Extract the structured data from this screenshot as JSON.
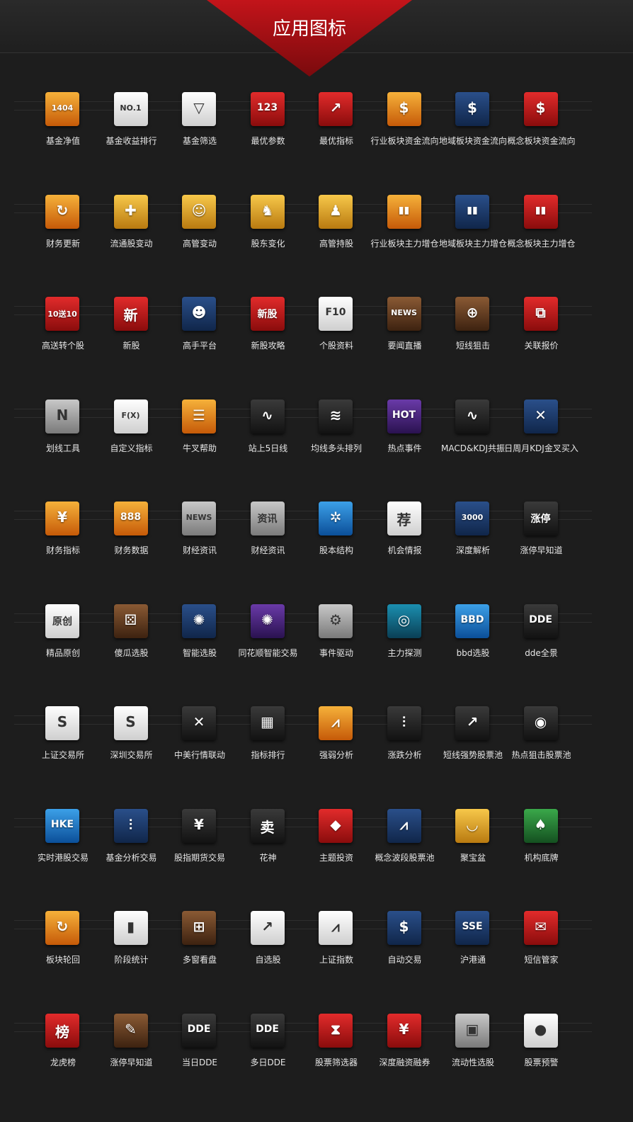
{
  "header": {
    "title": "应用图标"
  },
  "rows": [
    [
      {
        "label": "基金净值",
        "icon": "magnifier-numbers-icon",
        "glyph": "1404",
        "color": "orange"
      },
      {
        "label": "基金收益排行",
        "icon": "no1-coin-icon",
        "glyph": "NO.1",
        "color": "white"
      },
      {
        "label": "基金筛选",
        "icon": "funnel-icon",
        "glyph": "▽",
        "color": "white"
      },
      {
        "label": "最优参数",
        "icon": "number-grid-icon",
        "glyph": "123",
        "color": "red"
      },
      {
        "label": "最优指标",
        "icon": "arrow-up-chart-icon",
        "glyph": "↗",
        "color": "red"
      },
      {
        "label": "行业板块资金流向",
        "icon": "coins-arrow-icon",
        "glyph": "$",
        "color": "orange"
      },
      {
        "label": "地域板块资金流向",
        "icon": "coins-arrow-icon",
        "glyph": "$",
        "color": "navy"
      },
      {
        "label": "概念板块资金流向",
        "icon": "coins-arrow-icon",
        "glyph": "$",
        "color": "red"
      }
    ],
    [
      {
        "label": "财务更新",
        "icon": "refresh-icon",
        "glyph": "↻",
        "color": "orange"
      },
      {
        "label": "流通股变动",
        "icon": "hand-plus-icon",
        "glyph": "✚",
        "color": "gold"
      },
      {
        "label": "高管变动",
        "icon": "people-icon",
        "glyph": "☺",
        "color": "gold"
      },
      {
        "label": "股东变化",
        "icon": "person-chart-icon",
        "glyph": "♞",
        "color": "gold"
      },
      {
        "label": "高管持股",
        "icon": "person-line-icon",
        "glyph": "♟",
        "color": "gold"
      },
      {
        "label": "行业板块主力增仓",
        "icon": "bar-chart-icon",
        "glyph": "▮▮",
        "color": "orange"
      },
      {
        "label": "地域板块主力增仓",
        "icon": "bar-chart-icon",
        "glyph": "▮▮",
        "color": "navy"
      },
      {
        "label": "概念板块主力增仓",
        "icon": "bar-chart-icon",
        "glyph": "▮▮",
        "color": "red"
      }
    ],
    [
      {
        "label": "高送转个股",
        "icon": "envelope-icon",
        "glyph": "10送10",
        "color": "red"
      },
      {
        "label": "新股",
        "icon": "new-char-icon",
        "glyph": "新",
        "color": "red"
      },
      {
        "label": "高手平台",
        "icon": "brain-head-icon",
        "glyph": "☻",
        "color": "navy"
      },
      {
        "label": "新股攻略",
        "icon": "book-icon",
        "glyph": "新股",
        "color": "red"
      },
      {
        "label": "个股资料",
        "icon": "f10-icon",
        "glyph": "F10",
        "color": "white"
      },
      {
        "label": "要闻直播",
        "icon": "news-tv-icon",
        "glyph": "NEWS",
        "color": "brown"
      },
      {
        "label": "短线狙击",
        "icon": "crosshair-icon",
        "glyph": "⊕",
        "color": "brown"
      },
      {
        "label": "关联报价",
        "icon": "network-icon",
        "glyph": "⧉",
        "color": "red"
      }
    ],
    [
      {
        "label": "划线工具",
        "icon": "ruler-icon",
        "glyph": "N",
        "color": "gray"
      },
      {
        "label": "自定义指标",
        "icon": "robot-fx-icon",
        "glyph": "F(X)",
        "color": "white"
      },
      {
        "label": "牛叉帮助",
        "icon": "chat-cow-icon",
        "glyph": "☰",
        "color": "orange"
      },
      {
        "label": "站上5日线",
        "icon": "line-chart-icon",
        "glyph": "∿",
        "color": "dark"
      },
      {
        "label": "均线多头排列",
        "icon": "multi-line-icon",
        "glyph": "≋",
        "color": "dark"
      },
      {
        "label": "热点事件",
        "icon": "hot-fire-icon",
        "glyph": "HOT",
        "color": "purple"
      },
      {
        "label": "MACD&KDJ共振",
        "icon": "wave-arrows-icon",
        "glyph": "∿",
        "color": "dark"
      },
      {
        "label": "日周月KDJ金叉买入",
        "icon": "cross-chart-icon",
        "glyph": "✕",
        "color": "navy"
      }
    ],
    [
      {
        "label": "财务指标",
        "icon": "finance-chart-icon",
        "glyph": "¥",
        "color": "orange"
      },
      {
        "label": "财务数据",
        "icon": "finance-data-icon",
        "glyph": "888",
        "color": "orange"
      },
      {
        "label": "财经资讯",
        "icon": "newspaper-icon",
        "glyph": "NEWS",
        "color": "gray"
      },
      {
        "label": "财经资讯",
        "icon": "newspaper-icon",
        "glyph": "资讯",
        "color": "gray"
      },
      {
        "label": "股本结构",
        "icon": "molecule-icon",
        "glyph": "✲",
        "color": "blue"
      },
      {
        "label": "机会情报",
        "icon": "calligraphy-icon",
        "glyph": "荐",
        "color": "white"
      },
      {
        "label": "深度解析",
        "icon": "code-list-icon",
        "glyph": "3000",
        "color": "navy"
      },
      {
        "label": "涨停早知道",
        "icon": "limit-up-icon",
        "glyph": "涨停",
        "color": "dark"
      }
    ],
    [
      {
        "label": "精品原创",
        "icon": "ink-shapes-icon",
        "glyph": "原创",
        "color": "white"
      },
      {
        "label": "傻瓜选股",
        "icon": "dice-icon",
        "glyph": "⚄",
        "color": "brown"
      },
      {
        "label": "智能选股",
        "icon": "brain-icon",
        "glyph": "✺",
        "color": "navy"
      },
      {
        "label": "同花顺智能交易",
        "icon": "brain-coin-icon",
        "glyph": "✺",
        "color": "purple"
      },
      {
        "label": "事件驱动",
        "icon": "gears-icon",
        "glyph": "⚙",
        "color": "gray"
      },
      {
        "label": "主力探测",
        "icon": "radar-icon",
        "glyph": "◎",
        "color": "teal"
      },
      {
        "label": "bbd选股",
        "icon": "bbd-icon",
        "glyph": "BBD",
        "color": "blue"
      },
      {
        "label": "dde全景",
        "icon": "dde-icon",
        "glyph": "DDE",
        "color": "dark"
      }
    ],
    [
      {
        "label": "上证交易所",
        "icon": "sse-logo-icon",
        "glyph": "S",
        "color": "white"
      },
      {
        "label": "深圳交易所",
        "icon": "szse-logo-icon",
        "glyph": "S",
        "color": "white"
      },
      {
        "label": "中美行情联动",
        "icon": "flags-chart-icon",
        "glyph": "✕",
        "color": "dark"
      },
      {
        "label": "指标排行",
        "icon": "cubes-icon",
        "glyph": "▦",
        "color": "dark"
      },
      {
        "label": "强弱分析",
        "icon": "wave-signal-icon",
        "glyph": "⩘",
        "color": "orange"
      },
      {
        "label": "涨跌分析",
        "icon": "candle-chart-icon",
        "glyph": "⫶",
        "color": "dark"
      },
      {
        "label": "短线强势股票池",
        "icon": "trend-up-icon",
        "glyph": "↗",
        "color": "dark"
      },
      {
        "label": "热点狙击股票池",
        "icon": "target-icon",
        "glyph": "◉",
        "color": "dark"
      }
    ],
    [
      {
        "label": "实时港股交易",
        "icon": "hke-skyline-icon",
        "glyph": "HKE",
        "color": "blue"
      },
      {
        "label": "基金分析交易",
        "icon": "fund-coins-icon",
        "glyph": "⫶",
        "color": "navy"
      },
      {
        "label": "股指期货交易",
        "icon": "yuan-chart-icon",
        "glyph": "¥",
        "color": "dark"
      },
      {
        "label": "花神",
        "icon": "buy-sell-icon",
        "glyph": "卖",
        "color": "dark"
      },
      {
        "label": "主题投资",
        "icon": "gem-icon",
        "glyph": "◆",
        "color": "red"
      },
      {
        "label": "概念波段股票池",
        "icon": "mountain-chart-icon",
        "glyph": "⩘",
        "color": "navy"
      },
      {
        "label": "聚宝盆",
        "icon": "bowl-icon",
        "glyph": "◡",
        "color": "gold"
      },
      {
        "label": "机构底牌",
        "icon": "cards-icon",
        "glyph": "♠",
        "color": "green"
      }
    ],
    [
      {
        "label": "板块轮回",
        "icon": "cycle-arrows-icon",
        "glyph": "↻",
        "color": "orange"
      },
      {
        "label": "阶段统计",
        "icon": "stat-bars-icon",
        "glyph": "▮",
        "color": "white"
      },
      {
        "label": "多窗看盘",
        "icon": "multi-window-icon",
        "glyph": "⊞",
        "color": "brown"
      },
      {
        "label": "自选股",
        "icon": "rising-arrow-icon",
        "glyph": "↗",
        "color": "white"
      },
      {
        "label": "上证指数",
        "icon": "index-line-icon",
        "glyph": "⩘",
        "color": "white"
      },
      {
        "label": "自动交易",
        "icon": "gold-stack-icon",
        "glyph": "$",
        "color": "navy"
      },
      {
        "label": "沪港通",
        "icon": "sse-hke-icon",
        "glyph": "SSE",
        "color": "navy"
      },
      {
        "label": "短信管家",
        "icon": "message-box-icon",
        "glyph": "✉",
        "color": "red"
      }
    ],
    [
      {
        "label": "龙虎榜",
        "icon": "ranking-char-icon",
        "glyph": "榜",
        "color": "red"
      },
      {
        "label": "涨停早知道",
        "icon": "book-pen-icon",
        "glyph": "✎",
        "color": "brown"
      },
      {
        "label": "当日DDE",
        "icon": "dde-curve-icon",
        "glyph": "DDE",
        "color": "dark"
      },
      {
        "label": "多日DDE",
        "icon": "dde-curve-icon",
        "glyph": "DDE",
        "color": "dark"
      },
      {
        "label": "股票筛选器",
        "icon": "hourglass-icon",
        "glyph": "⧗",
        "color": "red"
      },
      {
        "label": "深度融资融券",
        "icon": "yuan-coins-icon",
        "glyph": "¥",
        "color": "red"
      },
      {
        "label": "流动性选股",
        "icon": "lock-box-icon",
        "glyph": "▣",
        "color": "gray"
      },
      {
        "label": "股票预警",
        "icon": "alarm-light-icon",
        "glyph": "●",
        "color": "white"
      }
    ]
  ]
}
